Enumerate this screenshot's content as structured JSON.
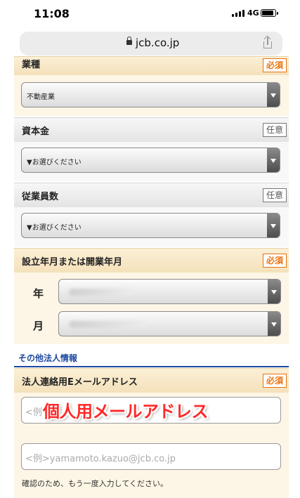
{
  "status_bar": {
    "time": "11:08",
    "network": "4G"
  },
  "browser": {
    "url": "jcb.co.jp"
  },
  "form": {
    "industry": {
      "label": "業種",
      "badge": "必須",
      "value": "不動産業"
    },
    "capital": {
      "label": "資本金",
      "badge": "任意",
      "value": "▼お選びください"
    },
    "employees": {
      "label": "従業員数",
      "badge": "任意",
      "value": "▼お選びください"
    },
    "founded": {
      "label": "設立年月または開業年月",
      "badge": "必須",
      "year_label": "年",
      "month_label": "月"
    },
    "other_info": {
      "heading": "その他法人情報"
    },
    "email": {
      "label": "法人連絡用Eメールアドレス",
      "badge": "必須",
      "placeholder_1": "<例",
      "placeholder_2": "<例>yamamoto.kazuo@jcb.co.jp",
      "confirm_note": "確認のため、もう一度入力してください。"
    }
  },
  "annotation": {
    "text": "個人用メールアドレス",
    "color": "#ff2a2a"
  }
}
